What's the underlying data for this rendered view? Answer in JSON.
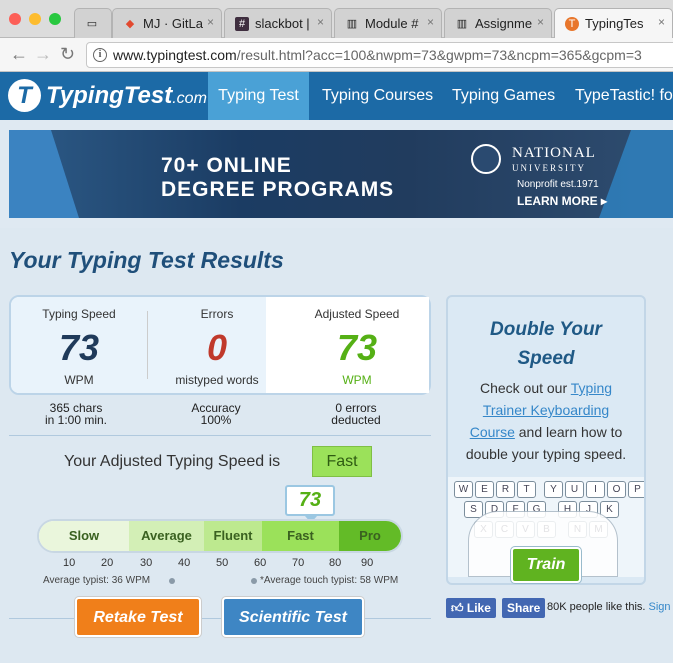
{
  "browser": {
    "tabs": [
      {
        "label": "",
        "icon": "page-icon"
      },
      {
        "label": "MJ · GitLa",
        "icon": "gitlab-icon"
      },
      {
        "label": "slackbot |",
        "icon": "slack-icon"
      },
      {
        "label": "Module #",
        "icon": "book-icon"
      },
      {
        "label": "Assignme",
        "icon": "book-icon"
      },
      {
        "label": "TypingTes",
        "icon": "typingtest-icon",
        "active": true
      }
    ],
    "url_host": "www.typingtest.com",
    "url_path": "/result.html?acc=100&nwpm=73&gwpm=73&ncpm=365&gcpm=3"
  },
  "site": {
    "logo_name": "TypingTest",
    "logo_domain": ".com",
    "nav": [
      "Typing Test",
      "Typing Courses",
      "Typing Games",
      "TypeTastic! for"
    ]
  },
  "ad": {
    "headline_1": "70+ ONLINE",
    "headline_2": "DEGREE PROGRAMS",
    "org_1": "NATIONAL",
    "org_2": "UNIVERSITY",
    "nonprofit": "Nonprofit est.1971",
    "cta": "LEARN MORE ▸"
  },
  "results": {
    "page_title": "Your Typing Test Results",
    "speed_label": "Typing Speed",
    "speed_value": "73",
    "speed_unit": "WPM",
    "errors_label": "Errors",
    "errors_value": "0",
    "errors_unit": "mistyped words",
    "adjusted_label": "Adjusted Speed",
    "adjusted_value": "73",
    "adjusted_unit": "WPM",
    "chars_1": "365 chars",
    "chars_2": "in 1:00 min.",
    "accuracy_label": "Accuracy",
    "accuracy_value": "100%",
    "deducted_1": "0 errors",
    "deducted_2": "deducted",
    "adjusted_sentence": "Your Adjusted Typing Speed is",
    "rating": "Fast",
    "score_bubble": "73"
  },
  "scale": {
    "segments": [
      "Slow",
      "Average",
      "Fluent",
      "Fast",
      "Pro"
    ],
    "colors": [
      "#eaf6dc",
      "#d3efb6",
      "#bde98f",
      "#9be15a",
      "#63bb27"
    ],
    "ticks": [
      "10",
      "20",
      "30",
      "40",
      "50",
      "60",
      "70",
      "80",
      "90"
    ],
    "avg_typist": "Average typist: 36 WPM",
    "avg_touch": "*Average touch typist: 58 WPM"
  },
  "buttons": {
    "retake": "Retake Test",
    "scientific": "Scientific Test"
  },
  "panel": {
    "title_1": "Double Your",
    "title_2": "Speed",
    "text_1": "Check out our",
    "link": "Typing Trainer Keyboarding Course",
    "text_2": "and learn how to double your typing speed.",
    "keys": [
      "W",
      "E",
      "R",
      "T",
      "Y",
      "U",
      "I",
      "O",
      "P",
      "S",
      "D",
      "F",
      "G",
      "H",
      "J",
      "K",
      "X",
      "C",
      "V",
      "B",
      "N",
      "M"
    ],
    "train": "Train"
  },
  "social": {
    "like": "Like",
    "share": "Share",
    "count": "80K people like this.",
    "signup": "Sign"
  }
}
